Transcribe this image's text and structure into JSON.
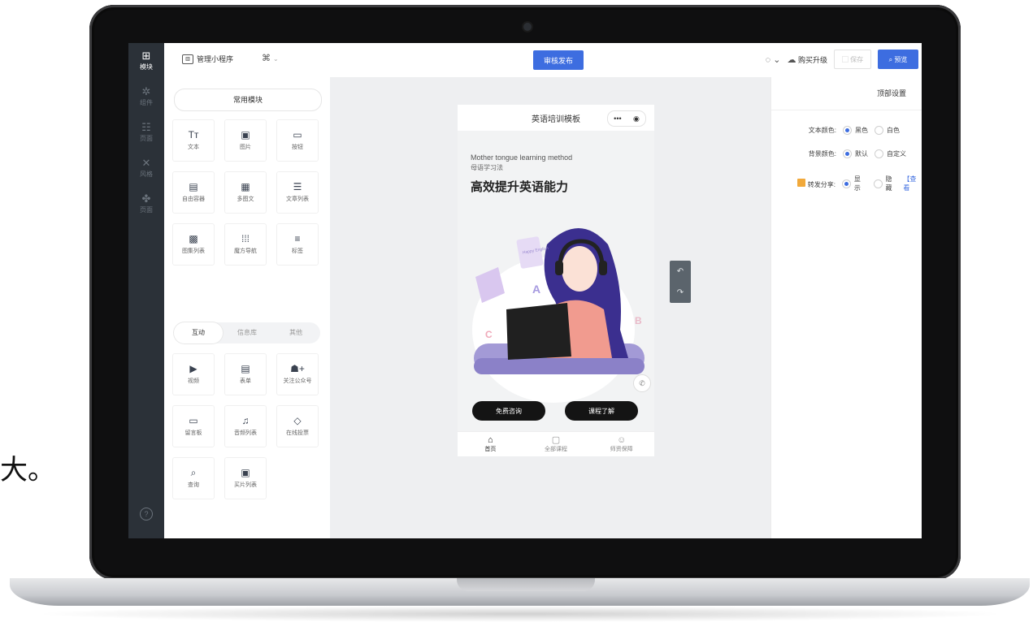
{
  "overlay_text": "大。",
  "rail": {
    "items": [
      {
        "label": "模块",
        "icon": "plus-square-icon"
      },
      {
        "label": "组件",
        "icon": "settings-icon"
      },
      {
        "label": "页面",
        "icon": "layers-icon"
      },
      {
        "label": "风格",
        "icon": "magic-wand-icon"
      },
      {
        "label": "页面",
        "icon": "speaker-icon"
      }
    ],
    "help": "?"
  },
  "topbar": {
    "manage_label": "管理小程序",
    "publish_label": "审核发布",
    "buy_label": "购买升级",
    "save_label": "保存",
    "preview_label": "预览"
  },
  "panel": {
    "common_label": "常用模块",
    "common_tiles": [
      {
        "label": "文本",
        "icon": "text-icon"
      },
      {
        "label": "图片",
        "icon": "image-icon"
      },
      {
        "label": "按钮",
        "icon": "button-icon"
      },
      {
        "label": "自由容器",
        "icon": "container-icon"
      },
      {
        "label": "多图文",
        "icon": "multi-image-icon"
      },
      {
        "label": "文章列表",
        "icon": "article-list-icon"
      },
      {
        "label": "图集列表",
        "icon": "gallery-list-icon"
      },
      {
        "label": "魔方导航",
        "icon": "grid-nav-icon"
      },
      {
        "label": "标签",
        "icon": "tag-icon"
      }
    ],
    "tabs": [
      "互动",
      "信息库",
      "其他"
    ],
    "interact_tiles": [
      {
        "label": "视频",
        "icon": "video-icon"
      },
      {
        "label": "表单",
        "icon": "form-icon"
      },
      {
        "label": "关注公众号",
        "icon": "follow-icon"
      },
      {
        "label": "留言板",
        "icon": "message-board-icon"
      },
      {
        "label": "音频列表",
        "icon": "audio-list-icon"
      },
      {
        "label": "在线投票",
        "icon": "vote-icon"
      },
      {
        "label": "查询",
        "icon": "search-doc-icon"
      },
      {
        "label": "买片列表",
        "icon": "photo-list-icon"
      }
    ]
  },
  "phone": {
    "title": "英语培训模板",
    "hero": {
      "en": "Mother tongue learning method",
      "cn": "母语学习法",
      "title": "高效提升英语能力",
      "book_text": "Happy English",
      "letters": [
        "A",
        "B",
        "C"
      ]
    },
    "btn_consult": "免费咨询",
    "btn_course": "课程了解",
    "nav": [
      {
        "label": "首页",
        "icon": "home-icon"
      },
      {
        "label": "全部课程",
        "icon": "course-icon"
      },
      {
        "label": "师资保障",
        "icon": "teacher-icon"
      }
    ]
  },
  "props": {
    "title": "顶部设置",
    "rows": [
      {
        "label": "文本颜色:",
        "opt1": "黑色",
        "opt2": "白色"
      },
      {
        "label": "背景颜色:",
        "opt1": "默认",
        "opt2": "自定义"
      },
      {
        "label": "转发分享:",
        "opt1": "显示",
        "opt2": "隐藏",
        "link": "【查看"
      }
    ]
  },
  "colors": {
    "accent": "#3d6de0",
    "rail": "#2b3138"
  }
}
